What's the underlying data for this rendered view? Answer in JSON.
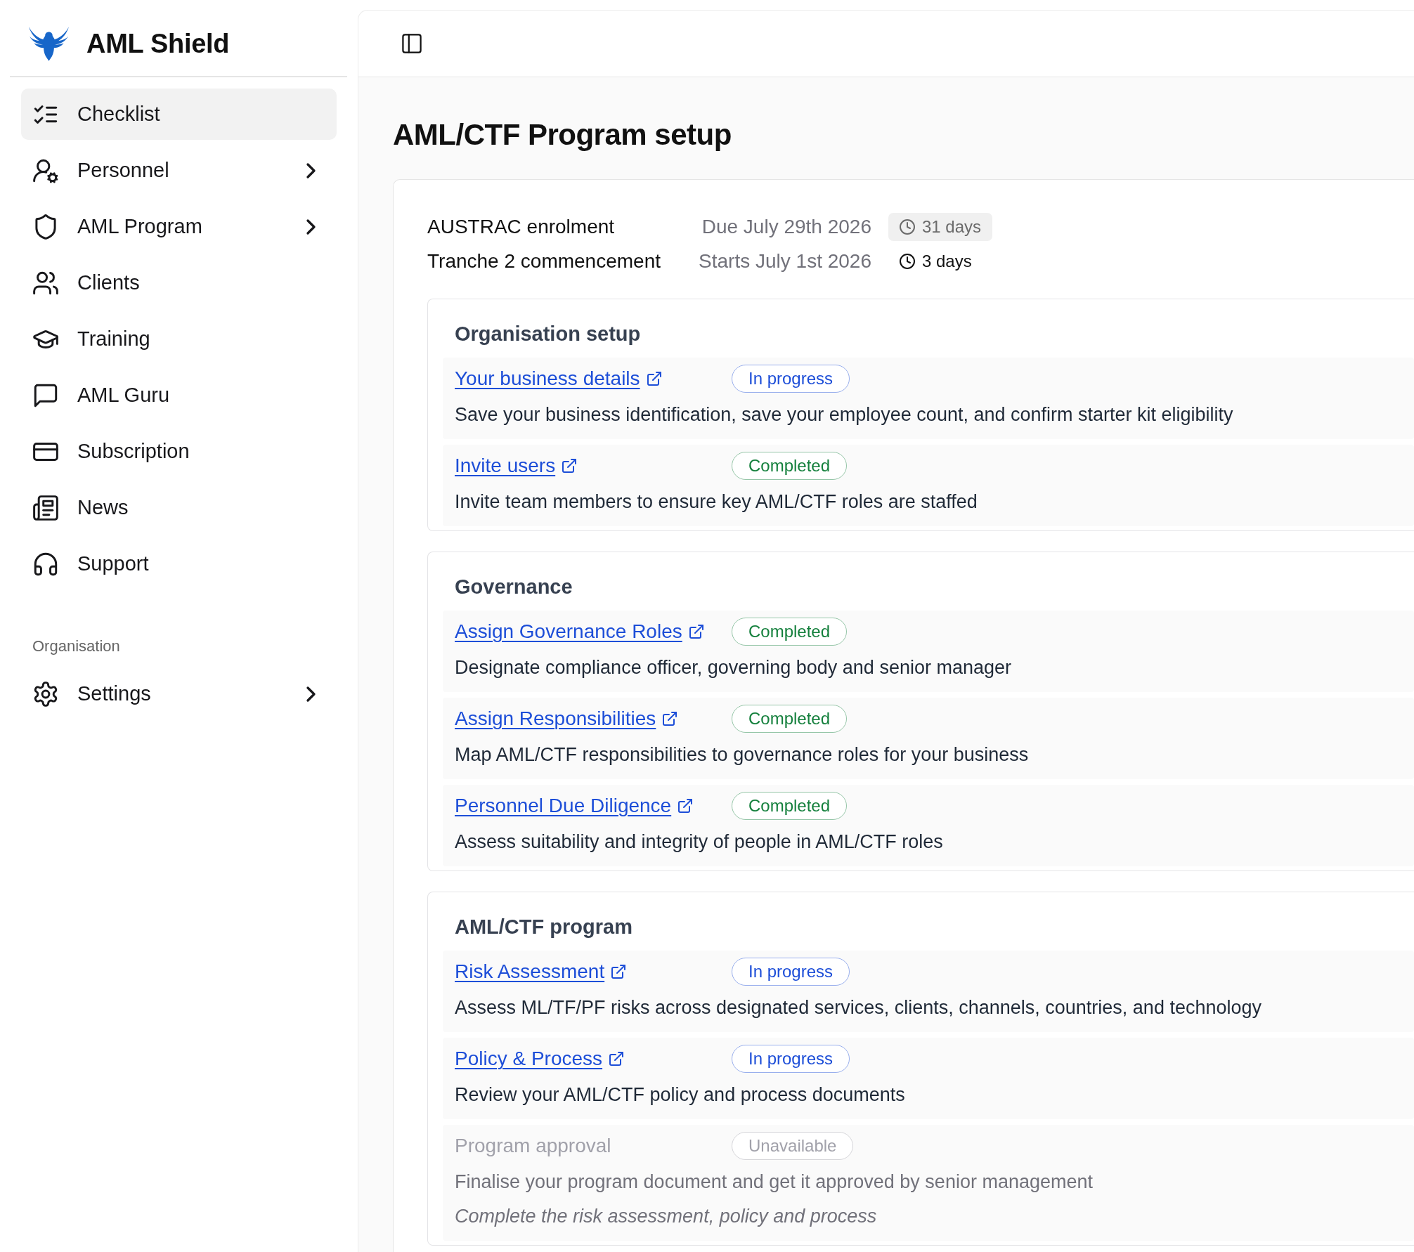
{
  "sidebar": {
    "brand": "AML Shield",
    "groups": [
      {
        "items": [
          {
            "label": "Checklist",
            "selected": true,
            "expandable": false
          },
          {
            "label": "Personnel",
            "selected": false,
            "expandable": true
          },
          {
            "label": "AML Program",
            "selected": false,
            "expandable": true
          },
          {
            "label": "Clients",
            "selected": false,
            "expandable": false
          },
          {
            "label": "Training",
            "selected": false,
            "expandable": false
          },
          {
            "label": "AML Guru",
            "selected": false,
            "expandable": false
          },
          {
            "label": "Subscription",
            "selected": false,
            "expandable": false
          },
          {
            "label": "News",
            "selected": false,
            "expandable": false
          },
          {
            "label": "Support",
            "selected": false,
            "expandable": false
          }
        ]
      },
      {
        "title": "Organisation",
        "items": [
          {
            "label": "Settings",
            "selected": false,
            "expandable": true
          }
        ]
      }
    ]
  },
  "page": {
    "title": "AML/CTF Program setup",
    "deadlines": [
      {
        "label": "AUSTRAC enrolment",
        "date": "Due July 29th 2026",
        "remaining": "31 days",
        "muted": true
      },
      {
        "label": "Tranche 2 commencement",
        "date": "Starts July 1st 2026",
        "remaining": "3 days",
        "muted": false
      }
    ],
    "sections": [
      {
        "title": "Organisation setup",
        "tasks": [
          {
            "title": "Your business details",
            "badge": {
              "label": "In progress",
              "color": "#1d4ed8"
            },
            "description": "Save your business identification, save your employee count, and confirm starter kit eligibility",
            "disabled": false
          },
          {
            "title": "Invite users",
            "badge": {
              "label": "Completed",
              "color": "#15803d"
            },
            "description": "Invite team members to ensure key AML/CTF roles are staffed",
            "disabled": false
          }
        ]
      },
      {
        "title": "Governance",
        "tasks": [
          {
            "title": "Assign Governance Roles",
            "badge": {
              "label": "Completed",
              "color": "#15803d"
            },
            "description": "Designate compliance officer, governing body and senior manager",
            "disabled": false
          },
          {
            "title": "Assign Responsibilities",
            "badge": {
              "label": "Completed",
              "color": "#15803d"
            },
            "description": "Map AML/CTF responsibilities to governance roles for your business",
            "disabled": false
          },
          {
            "title": "Personnel Due Diligence",
            "badge": {
              "label": "Completed",
              "color": "#15803d"
            },
            "description": "Assess suitability and integrity of people in AML/CTF roles",
            "disabled": false
          }
        ]
      },
      {
        "title": "AML/CTF program",
        "tasks": [
          {
            "title": "Risk Assessment",
            "badge": {
              "label": "In progress",
              "color": "#1d4ed8"
            },
            "description": "Assess ML/TF/PF risks across designated services, clients, channels, countries, and technology",
            "disabled": false
          },
          {
            "title": "Policy & Process",
            "badge": {
              "label": "In progress",
              "color": "#1d4ed8"
            },
            "description": "Review your AML/CTF policy and process documents",
            "disabled": false
          },
          {
            "title": "Program approval",
            "badge": {
              "label": "Unavailable",
              "color": "#a1a1aa"
            },
            "description": "Finalise your program document and get it approved by senior management",
            "note": "Complete the risk assessment, policy and process",
            "disabled": true
          }
        ]
      }
    ]
  }
}
